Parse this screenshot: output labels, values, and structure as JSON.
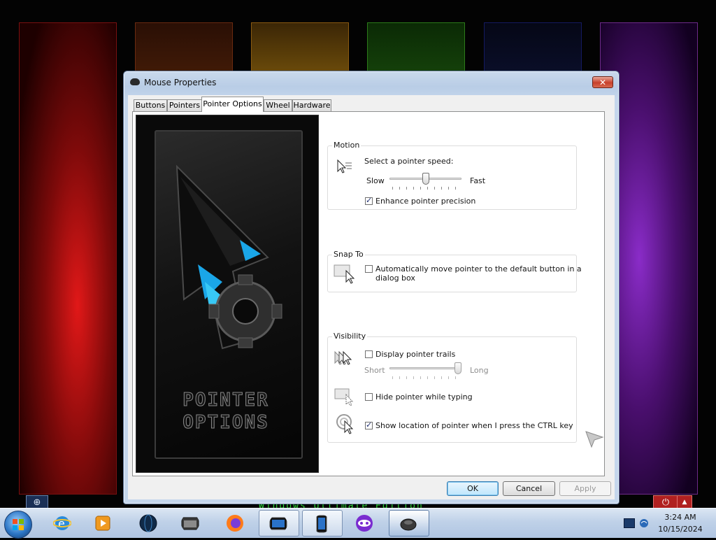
{
  "desktop": {
    "edition_text": "Windows Ultimate Edition",
    "taskbar": {
      "start_icon": "windows-orb-icon",
      "pinned": [
        {
          "name": "internet-explorer-icon"
        },
        {
          "name": "media-player-icon"
        },
        {
          "name": "globe-icon"
        },
        {
          "name": "file-explorer-icon"
        },
        {
          "name": "firefox-icon"
        },
        {
          "name": "display-icon"
        },
        {
          "name": "tablet-icon"
        },
        {
          "name": "tor-mask-icon"
        },
        {
          "name": "mouse-icon"
        }
      ],
      "clock": {
        "time": "3:24 AM",
        "date": "10/15/2024"
      }
    }
  },
  "dialog": {
    "title": "Mouse Properties",
    "close_label": "✕",
    "tabs": [
      {
        "label": "Buttons"
      },
      {
        "label": "Pointers"
      },
      {
        "label": "Pointer Options",
        "active": true
      },
      {
        "label": "Wheel"
      },
      {
        "label": "Hardware"
      }
    ],
    "art_text_line1": "POINTER",
    "art_text_line2": "OPTIONS",
    "motion": {
      "group_label": "Motion",
      "speed_label": "Select a pointer speed:",
      "slow_label": "Slow",
      "fast_label": "Fast",
      "speed_value": 0.5,
      "enhance_label": "Enhance pointer precision",
      "enhance_checked": true
    },
    "snap": {
      "group_label": "Snap To",
      "auto_move_line1": "Automatically move pointer to the default button in a",
      "auto_move_line2": "dialog box",
      "auto_move_checked": false
    },
    "visibility": {
      "group_label": "Visibility",
      "trails_label": "Display pointer trails",
      "trails_checked": false,
      "short_label": "Short",
      "long_label": "Long",
      "trail_value": 1.0,
      "hide_label": "Hide pointer while typing",
      "hide_checked": false,
      "show_location_label": "Show location of pointer when I press the CTRL key",
      "show_location_checked": true
    },
    "buttons": {
      "ok": "OK",
      "cancel": "Cancel",
      "apply": "Apply"
    }
  }
}
